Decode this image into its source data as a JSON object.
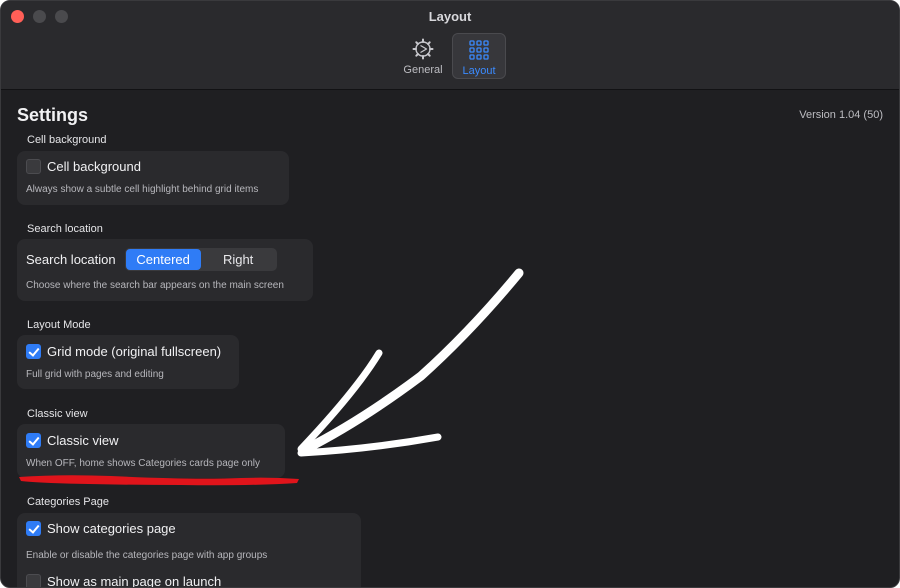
{
  "window": {
    "title": "Layout",
    "toolbar": [
      {
        "label": "General",
        "icon": "gear-icon",
        "selected": false
      },
      {
        "label": "Layout",
        "icon": "grid-icon",
        "selected": true
      }
    ]
  },
  "page": {
    "title": "Settings",
    "version": "Version 1.04 (50)"
  },
  "sections": [
    {
      "title": "Cell background",
      "item": {
        "label": "Cell background",
        "checked": false
      },
      "description": "Always show a subtle cell highlight behind grid items"
    },
    {
      "title": "Search location",
      "item": {
        "label": "Search location",
        "options": [
          "Centered",
          "Right"
        ],
        "selected": "Centered"
      },
      "description": "Choose where the search bar appears on the main screen"
    },
    {
      "title": "Layout Mode",
      "item": {
        "label": "Grid mode (original fullscreen)",
        "checked": true
      },
      "description": "Full grid with pages and editing"
    },
    {
      "title": "Classic view",
      "item": {
        "label": "Classic view",
        "checked": true
      },
      "description": "When OFF, home shows Categories cards page only"
    },
    {
      "title": "Categories Page",
      "items": [
        {
          "label": "Show categories page",
          "checked": true
        },
        {
          "label": "Show as main page on launch",
          "checked": false
        }
      ],
      "description": "Enable or disable the categories page with app groups"
    }
  ],
  "colors": {
    "accent": "#2f7cf6",
    "annotation_arrow": "#ffffff",
    "annotation_underline": "#e0141b"
  }
}
